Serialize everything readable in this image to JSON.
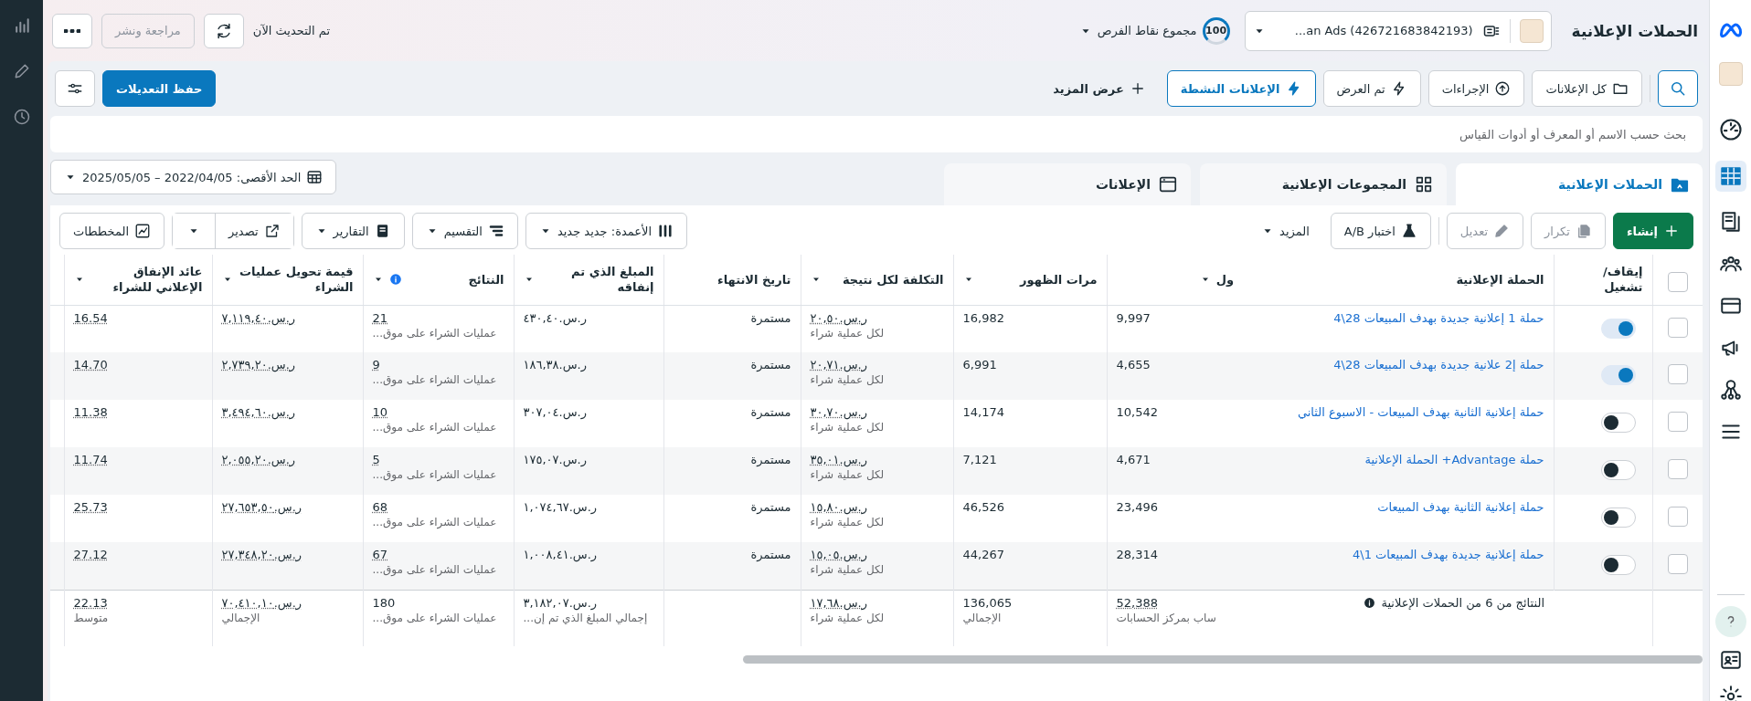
{
  "top_bar": {
    "title": "الحملات الإعلانية",
    "account": "...an Ads (426721683842193)",
    "score": "100",
    "score_label": "مجموع نقاط الفرص",
    "update_status": "تم التحديث الآن",
    "review_button": "مراجعة ونشر"
  },
  "filters": [
    {
      "label": "كل الإعلانات",
      "selected": false
    },
    {
      "label": "الإجراءات",
      "selected": false
    },
    {
      "label": "تم العرض",
      "selected": false
    },
    {
      "label": "الإعلانات النشطة",
      "selected": true
    }
  ],
  "show_more": "عرض المزيد",
  "save_button": "حفظ التعديلات",
  "search": {
    "placeholder": "بحث حسب الاسم أو المعرف أو أدوات القياس"
  },
  "level_tabs": [
    {
      "label": "الحملات الإعلانية",
      "selected": true
    },
    {
      "label": "المجموعات الإعلانية",
      "selected": false
    },
    {
      "label": "الإعلانات",
      "selected": false
    }
  ],
  "date_range": "الحد الأقصى: 2022/04/05 – 2025/05/05",
  "actions": [
    {
      "label": "إنشاء",
      "kind": "create",
      "disabled": false
    },
    {
      "label": "تكرار",
      "kind": "duplicate",
      "disabled": true
    },
    {
      "label": "تعديل",
      "kind": "edit",
      "disabled": true
    },
    {
      "label": "اختبار A/B",
      "kind": "test",
      "disabled": false
    },
    {
      "label": "المزيد",
      "kind": "more",
      "disabled": false
    }
  ],
  "view_tools": [
    {
      "label": "الأعمدة: جديد جديد",
      "kind": "columns"
    },
    {
      "label": "التقسيم",
      "kind": "breakdown"
    },
    {
      "label": "التقارير",
      "kind": "reports"
    },
    {
      "label": "تصدير",
      "kind": "export"
    },
    {
      "label": "المخططات",
      "kind": "charts"
    }
  ],
  "table": {
    "all_selected": false,
    "columns": [
      {
        "label": "إيقاف/ تشغيل",
        "menu": false,
        "info": false
      },
      {
        "label": "الحملة الإعلانية",
        "menu": false,
        "info": false
      },
      {
        "label": "ول",
        "menu": true,
        "info": false
      },
      {
        "label": "مرات الظهور",
        "menu": true,
        "info": false
      },
      {
        "label": "التكلفة لكل نتيجة",
        "menu": true,
        "info": false
      },
      {
        "label": "تاريخ الانتهاء",
        "menu": false,
        "info": false
      },
      {
        "label": "المبلغ الذي تم إنفاقه",
        "menu": true,
        "info": false
      },
      {
        "label": "النتائج",
        "menu": true,
        "info": true
      },
      {
        "label": "قيمة تحويل عمليات الشراء",
        "menu": true,
        "info": false
      },
      {
        "label": "عائد الإنفاق الإعلاني للشراء",
        "menu": true,
        "info": false
      }
    ],
    "rows": [
      {
        "selected": false,
        "on": true,
        "name": "حملة 1 إعلانية جديدة بهدف المبيعات 28\\4",
        "reach": "9,997",
        "impressions": "16,982",
        "cost": "ر.س.٢٠,٥٠",
        "cost_note": "لكل عملية شراء",
        "end_date": "مستمرة",
        "spent": "ر.س.٤٣٠,٤٠",
        "results": "21",
        "results_note": "عمليات الشراء على موق...",
        "value": "ر.س.٧,١١٩,٤٠",
        "roas": "16.54"
      },
      {
        "selected": false,
        "on": true,
        "name": "حملة إ2 علانية جديدة بهدف المبيعات 28\\4",
        "reach": "4,655",
        "impressions": "6,991",
        "cost": "ر.س.٢٠,٧١",
        "cost_note": "لكل عملية شراء",
        "end_date": "مستمرة",
        "spent": "ر.س.١٨٦,٣٨",
        "results": "9",
        "results_note": "عمليات الشراء على موق...",
        "value": "ر.س.٢,٧٣٩,٢٠",
        "roas": "14.70"
      },
      {
        "selected": false,
        "on": false,
        "name": "حملة إعلانية الثانية بهدف المبيعات - الاسبوع الثاني",
        "reach": "10,542",
        "impressions": "14,174",
        "cost": "ر.س.٣٠,٧٠",
        "cost_note": "لكل عملية شراء",
        "end_date": "مستمرة",
        "spent": "ر.س.٣٠٧,٠٤",
        "results": "10",
        "results_note": "عمليات الشراء على موق...",
        "value": "ر.س.٣,٤٩٤,٦٠",
        "roas": "11.38"
      },
      {
        "selected": false,
        "on": false,
        "name": "حملة Advantage+ الحملة الإعلانية",
        "reach": "4,671",
        "impressions": "7,121",
        "cost": "ر.س.٣٥,٠١",
        "cost_note": "لكل عملية شراء",
        "end_date": "مستمرة",
        "spent": "ر.س.١٧٥,٠٧",
        "results": "5",
        "results_note": "عمليات الشراء على موق...",
        "value": "ر.س.٢,٠٥٥,٢٠",
        "roas": "11.74"
      },
      {
        "selected": false,
        "on": false,
        "name": "حملة إعلانية الثانية بهدف المبيعات",
        "reach": "23,496",
        "impressions": "46,526",
        "cost": "ر.س.١٥,٨٠",
        "cost_note": "لكل عملية شراء",
        "end_date": "مستمرة",
        "spent": "ر.س.١,٠٧٤,٦٧",
        "results": "68",
        "results_note": "عمليات الشراء على موق...",
        "value": "ر.س.٢٧,٦٥٣,٥٠",
        "roas": "25.73"
      },
      {
        "selected": false,
        "on": false,
        "name": "حملة إعلانية جديدة بهدف المبيعات 1\\4",
        "reach": "28,314",
        "impressions": "44,267",
        "cost": "ر.س.١٥,٠٥",
        "cost_note": "لكل عملية شراء",
        "end_date": "مستمرة",
        "spent": "ر.س.١,٠٠٨,٤١",
        "results": "67",
        "results_note": "عمليات الشراء على موق...",
        "value": "ر.س.٢٧,٣٤٨,٢٠",
        "roas": "27.12"
      }
    ],
    "totals": {
      "label": "النتائج من 6 من الحملات الإعلانية",
      "reach": "52,388",
      "reach_note": "ساب بمركز الحسابات",
      "impressions": "136,065",
      "impressions_note": "الإجمالي",
      "cost": "ر.س.١٧,٦٨",
      "cost_note": "لكل عملية شراء",
      "spent": "ر.س.٣,١٨٢,٠٧",
      "spent_note": "إجمالي المبلغ الذي تم إن...",
      "results": "180",
      "results_note": "عمليات الشراء على موق...",
      "value": "ر.س.٧٠,٤١٠,١٠",
      "value_note": "الإجمالي",
      "roas": "22.13",
      "roas_note": "متوسط"
    }
  }
}
